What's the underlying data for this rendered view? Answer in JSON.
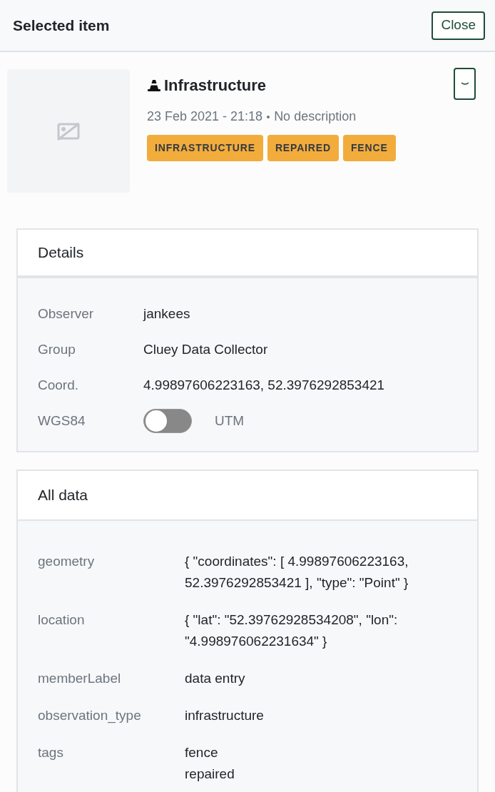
{
  "header": {
    "title": "Selected item",
    "close_button": "Close"
  },
  "item": {
    "title": "Infrastructure",
    "date": "23 Feb 2021 - 21:18",
    "description": "No description",
    "tags": [
      "INFRASTRUCTURE",
      "REPAIRED",
      "FENCE"
    ]
  },
  "details": {
    "title": "Details",
    "rows": [
      {
        "kind": "text",
        "label": "Observer",
        "value": "jankees"
      },
      {
        "kind": "text",
        "label": "Group",
        "value": "Cluey Data Collector"
      },
      {
        "kind": "text",
        "label": "Coord.",
        "value": "4.99897606223163, 52.3976292853421"
      },
      {
        "kind": "toggle",
        "label": "WGS84",
        "on": false,
        "value": "UTM"
      }
    ]
  },
  "all_data": {
    "title": "All data",
    "rows": [
      {
        "label": "geometry",
        "lines": [
          "{ \"coordinates\": [ 4.99897606223163, 52.3976292853421 ], \"type\": \"Point\" }"
        ]
      },
      {
        "label": "location",
        "lines": [
          "{ \"lat\": \"52.39762928534208\", \"lon\": \"4.998976062231634\" }"
        ]
      },
      {
        "label": "memberLabel",
        "lines": [
          "data entry"
        ]
      },
      {
        "label": "observation_type",
        "lines": [
          "infrastructure"
        ]
      },
      {
        "label": "tags",
        "lines": [
          "fence",
          "repaired"
        ]
      }
    ]
  }
}
